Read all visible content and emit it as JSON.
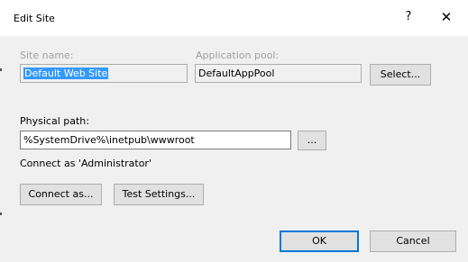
{
  "window": {
    "title": "Edit Site",
    "help_glyph": "?",
    "close_glyph": "✕"
  },
  "site_name": {
    "label": "Site name:",
    "value": "Default Web Site"
  },
  "app_pool": {
    "label": "Application pool:",
    "value": "DefaultAppPool",
    "select_label": "Select..."
  },
  "physical_path": {
    "label": "Physical path:",
    "value": "%SystemDrive%\\inetpub\\wwwroot",
    "browse_label": "..."
  },
  "connect_as_text": "Connect as 'Administrator'",
  "buttons": {
    "connect_as": "Connect as...",
    "test_settings": "Test Settings...",
    "ok": "OK",
    "cancel": "Cancel"
  }
}
